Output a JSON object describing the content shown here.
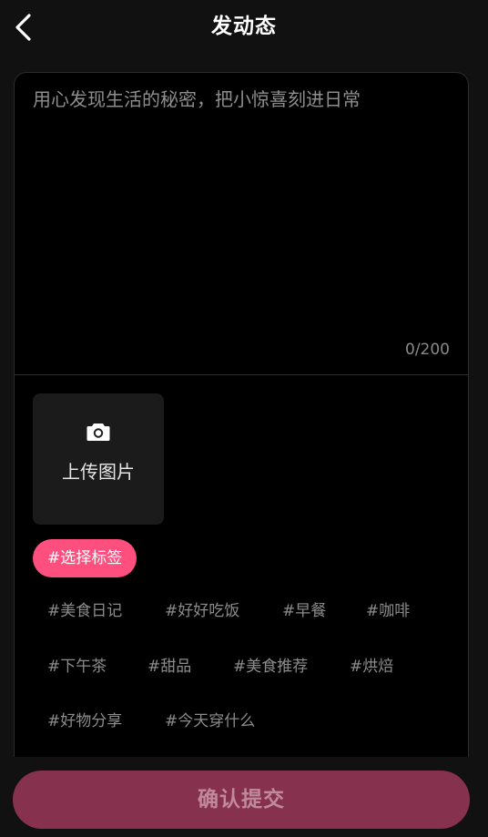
{
  "header": {
    "title": "发动态",
    "back_icon": "chevron-left-icon"
  },
  "editor": {
    "placeholder": "用心发现生活的秘密，把小惊喜刻进日常",
    "value": "",
    "char_count": "0/200"
  },
  "upload": {
    "icon": "camera-icon",
    "label": "上传图片"
  },
  "tags": {
    "select_label": "#选择标签",
    "items": [
      "#美食日记",
      "#好好吃饭",
      "#早餐",
      "#咖啡",
      "#下午茶",
      "#甜品",
      "#美食推荐",
      "#烘焙",
      "#好物分享",
      "#今天穿什么"
    ]
  },
  "footer": {
    "submit_label": "确认提交"
  },
  "colors": {
    "accent": "#ff4f7e",
    "submit_bg": "#86314d",
    "background": "#111111",
    "card_bg": "#000000"
  }
}
